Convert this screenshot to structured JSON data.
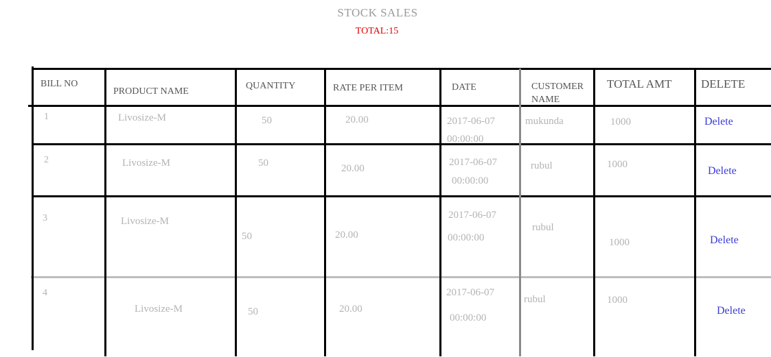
{
  "page": {
    "title": "STOCK SALES",
    "total": "TOTAL:15"
  },
  "table": {
    "headers": {
      "bill_no": "BILL NO",
      "product_name": "PRODUCT NAME",
      "quantity": "QUANTITY",
      "rate_per_item": "RATE PER ITEM",
      "date": "DATE",
      "customer_name_1": "CUSTOMER",
      "customer_name_2": "NAME",
      "total_amt": "TOTAL AMT",
      "delete": "DELETE"
    },
    "rows": [
      {
        "bill_no": "1",
        "product": "Livosize-M",
        "quantity": "50",
        "rate": "20.00",
        "date_day": "2017-06-07",
        "date_time": "00:00:00",
        "customer": "mukunda",
        "total": "1000",
        "delete": "Delete"
      },
      {
        "bill_no": "2",
        "product": "Livosize-M",
        "quantity": "50",
        "rate": "20.00",
        "date_day": "2017-06-07",
        "date_time": "00:00:00",
        "customer": "rubul",
        "total": "1000",
        "delete": "Delete"
      },
      {
        "bill_no": "3",
        "product": "Livosize-M",
        "quantity": "50",
        "rate": "20.00",
        "date_day": "2017-06-07",
        "date_time": "00:00:00",
        "customer": "rubul",
        "total": "1000",
        "delete": "Delete"
      },
      {
        "bill_no": "4",
        "product": "Livosize-M",
        "quantity": "50",
        "rate": "20.00",
        "date_day": "2017-06-07",
        "date_time": "00:00:00",
        "customer": "rubul",
        "total": "1000",
        "delete": "Delete"
      }
    ]
  }
}
